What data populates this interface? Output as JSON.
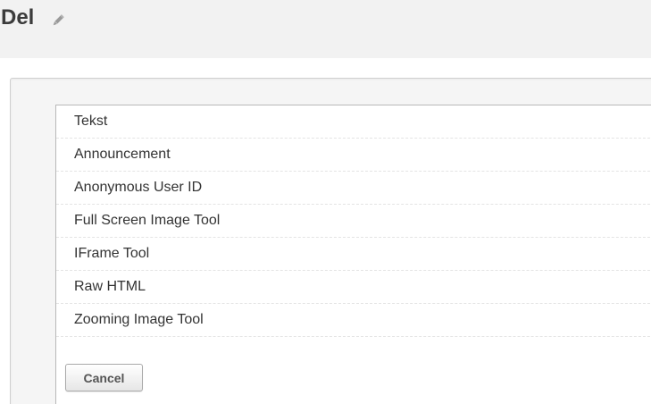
{
  "header": {
    "title": "Del",
    "edit_icon": "pencil-icon"
  },
  "menu": {
    "items": [
      {
        "label": "Tekst"
      },
      {
        "label": "Announcement"
      },
      {
        "label": "Anonymous User ID"
      },
      {
        "label": "Full Screen Image Tool"
      },
      {
        "label": "IFrame Tool"
      },
      {
        "label": "Raw HTML"
      },
      {
        "label": "Zooming Image Tool"
      }
    ],
    "cancel_label": "Cancel"
  },
  "colors": {
    "header_bg": "#f2f2f2",
    "panel_bg": "#f5f5f5",
    "menu_bg": "#ffffff",
    "text": "#333333"
  }
}
